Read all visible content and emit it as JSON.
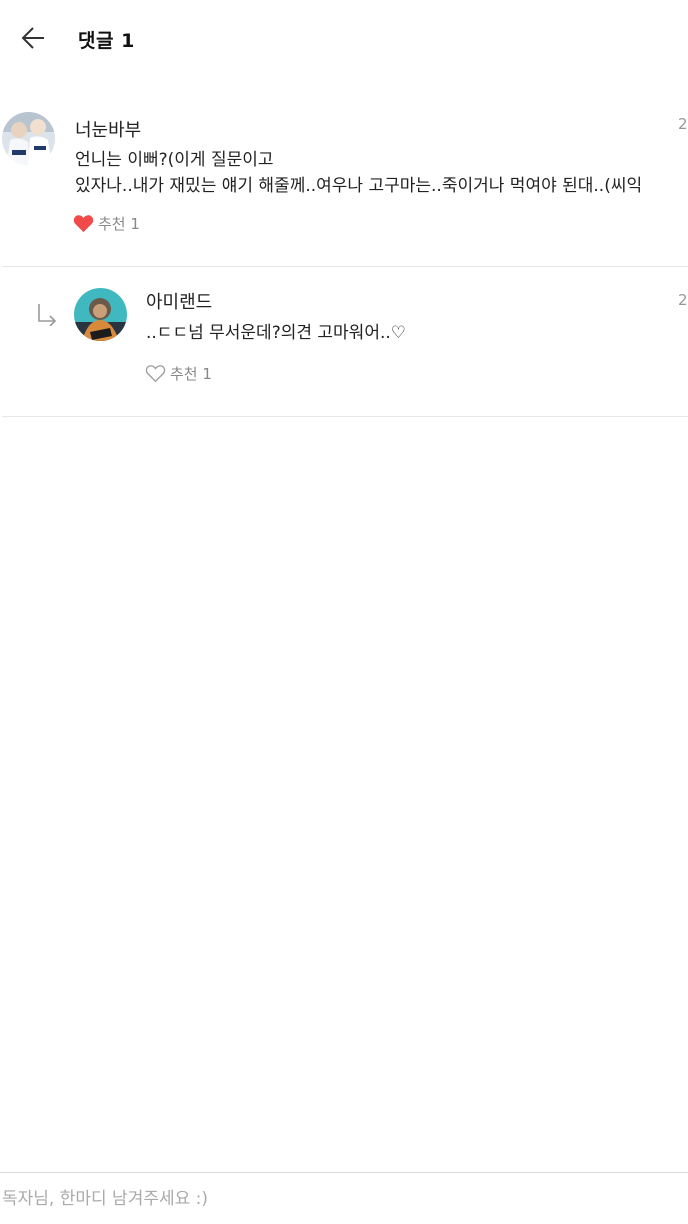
{
  "header": {
    "title": "댓글 1",
    "back_icon": "arrow-left-icon"
  },
  "comments": [
    {
      "author": "너눈바부",
      "date_fragment": "2",
      "lines": [
        "언니는 이뻐?(이게 질문이고",
        "있자나..내가 재밌는 얘기 해줄께..여우나 고구마는..죽이거나 먹여야 된대..(씨익"
      ],
      "like_label": "추천 1",
      "liked": true,
      "avatar_icon": "user-avatar-photo"
    },
    {
      "author": "아미랜드",
      "date_fragment": "2",
      "lines": [
        "..ㄷㄷ넘 무서운데?의견 고마워어..♡"
      ],
      "like_label": "추천 1",
      "liked": false,
      "is_reply": true,
      "avatar_icon": "user-avatar-photo"
    }
  ],
  "composer": {
    "placeholder": "독자님, 한마디 남겨주세요 :)"
  },
  "colors": {
    "heart_active": "#f04a4a",
    "heart_inactive": "#9a9a9a",
    "meta_text": "#888888",
    "divider": "#e6e6e6"
  }
}
